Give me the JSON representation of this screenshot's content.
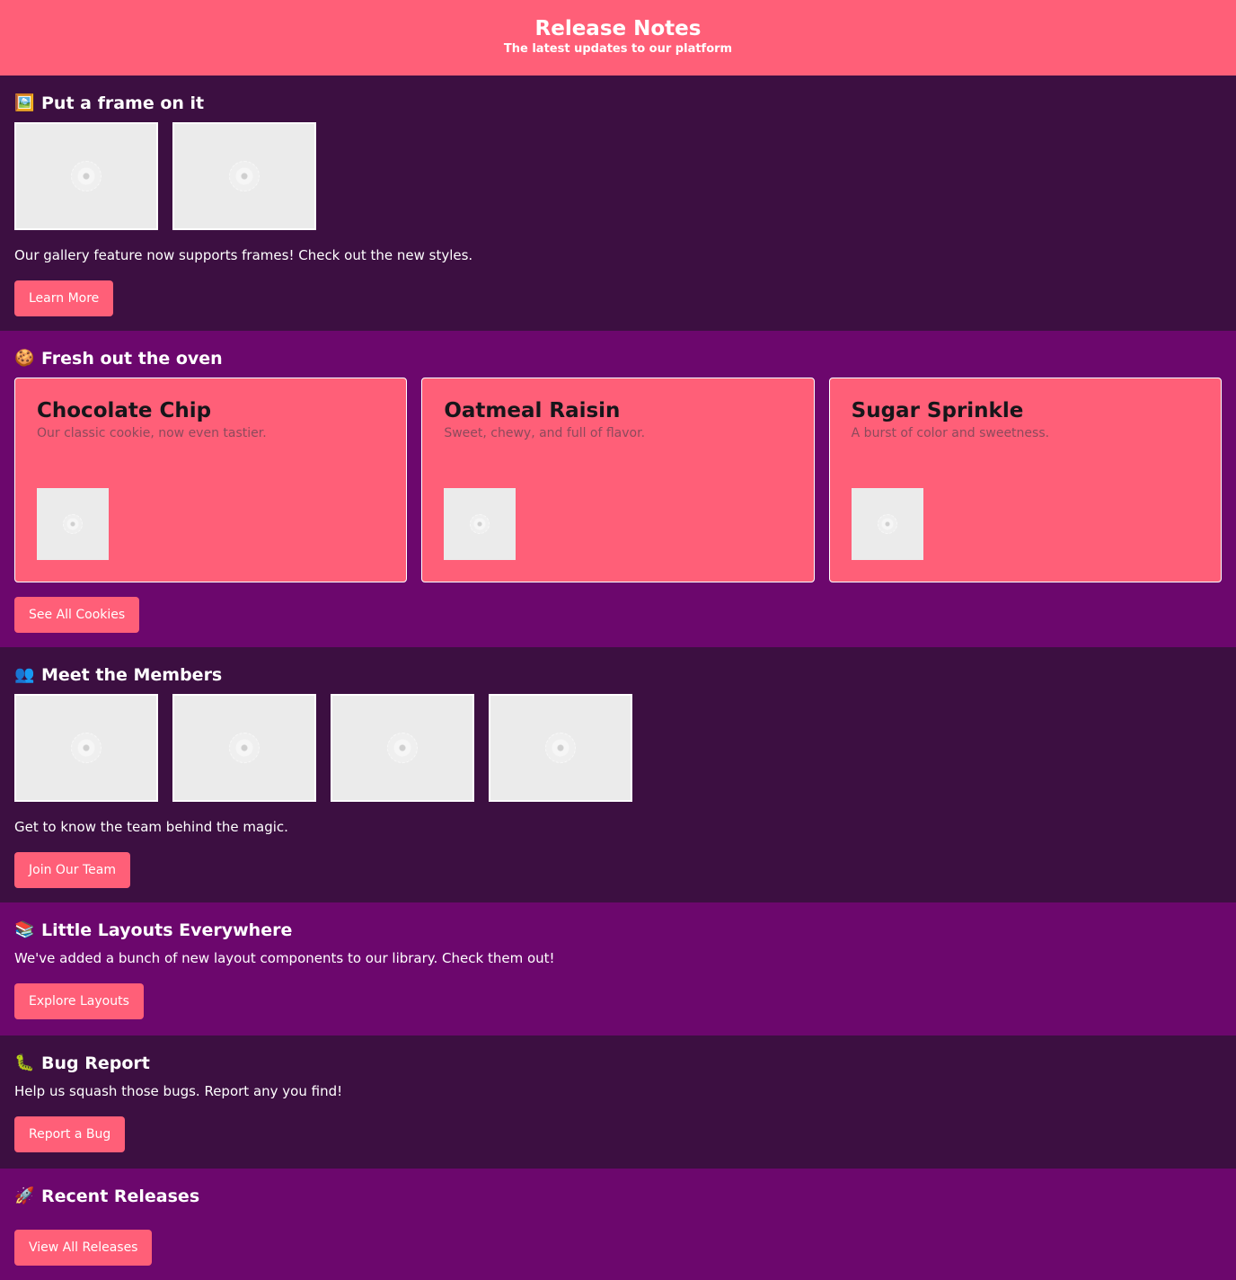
{
  "header": {
    "title": "Release Notes",
    "subtitle": "The latest updates to our platform"
  },
  "sections": {
    "frame": {
      "emoji": "🖼️",
      "title": "Put a frame on it",
      "text": "Our gallery feature now supports frames! Check out the new styles.",
      "button": "Learn More"
    },
    "oven": {
      "emoji": "🍪",
      "title": "Fresh out the oven",
      "cards": [
        {
          "title": "Chocolate Chip",
          "desc": "Our classic cookie, now even tastier."
        },
        {
          "title": "Oatmeal Raisin",
          "desc": "Sweet, chewy, and full of flavor."
        },
        {
          "title": "Sugar Sprinkle",
          "desc": "A burst of color and sweetness."
        }
      ],
      "button": "See All Cookies"
    },
    "members": {
      "emoji": "👥",
      "title": "Meet the Members",
      "text": "Get to know the team behind the magic.",
      "button": "Join Our Team"
    },
    "layouts": {
      "emoji": "📚",
      "title": "Little Layouts Everywhere",
      "text": "We've added a bunch of new layout components to our library. Check them out!",
      "button": "Explore Layouts"
    },
    "bugs": {
      "emoji": "🐛",
      "title": "Bug Report",
      "text": "Help us squash those bugs. Report any you find!",
      "button": "Report a Bug"
    },
    "releases": {
      "emoji": "🚀",
      "title": "Recent Releases",
      "button": "View All Releases"
    }
  },
  "colors": {
    "accent": "#ff5f78",
    "dark": "#3c0f41",
    "purple": "#6c076d"
  }
}
